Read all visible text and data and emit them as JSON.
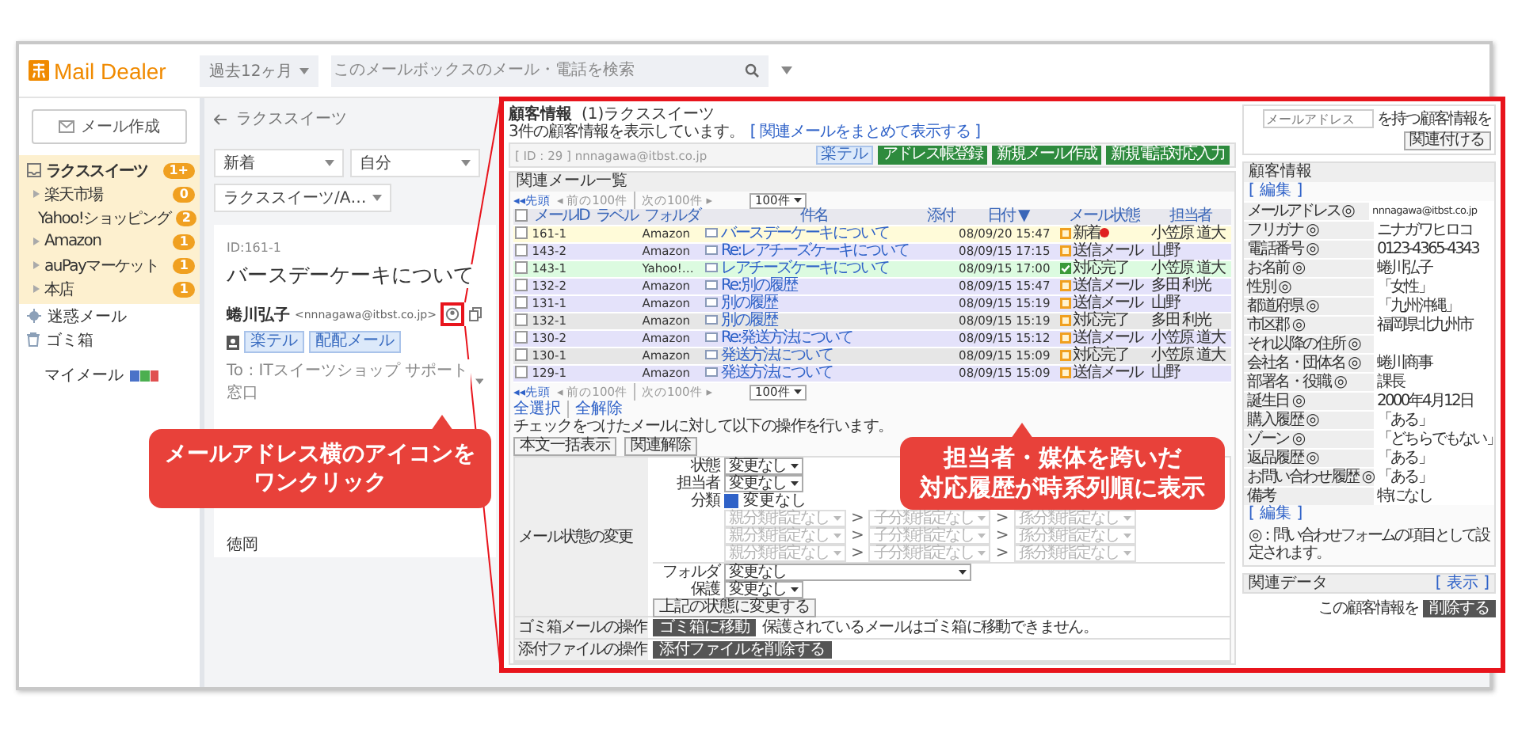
{
  "app": {
    "logo": "Mail Dealer",
    "period": "過去12ヶ月",
    "search_placeholder": "このメールボックスのメール・電話を検索"
  },
  "sidebar": {
    "compose": "メール作成",
    "folders": [
      {
        "label": "ラクススイーツ",
        "badge": "1+",
        "selected": true,
        "children": [
          {
            "label": "楽天市場",
            "badge": "0",
            "selected": false
          },
          {
            "label": "Yahoo!ショッピング",
            "badge": "2",
            "selected": false
          },
          {
            "label": "Amazon",
            "badge": "1",
            "selected": false
          },
          {
            "label": "auPayマーケット",
            "badge": "1",
            "selected": false
          },
          {
            "label": "本店",
            "badge": "1",
            "selected": false
          }
        ]
      }
    ],
    "others": [
      {
        "label": "迷惑メール",
        "kind": "spam"
      },
      {
        "label": "ゴミ箱",
        "kind": "trash"
      }
    ],
    "my_mail": "マイメール"
  },
  "mail": {
    "back": "ラクススイーツ",
    "filters": [
      "新着",
      "自分",
      "ラクススイーツ/A…"
    ],
    "id": "ID:161-1",
    "subject": "バースデーケーキについて",
    "sender": "蜷川弘子",
    "address": "<nnnagawa@itbst.co.jp>",
    "tags": [
      "楽テル",
      "配配メール"
    ],
    "to": "To : ITスイーツショップ サポート窓口",
    "signature": "徳岡"
  },
  "panel": {
    "title": "顧客情報",
    "subtitle": "(1)ラクススイーツ",
    "summary": "3件の顧客情報を表示しています。",
    "summary_link": "[ 関連メールをまとめて表示する ]",
    "record": "[ ID : 29 ]  nnnagawa@itbst.co.jp",
    "record_tag": "楽テル",
    "record_buttons": [
      "アドレス帳登録",
      "新規メール作成",
      "新規電話対応入力"
    ],
    "list_title": "関連メール一覧",
    "pager_top": {
      "first": "◂◂先頭",
      "prev": "◂ 前の100件",
      "next": "次の100件 ▸",
      "per_page": "100件"
    },
    "pager_bottom": {
      "first": "◂◂先頭",
      "prev": "◂ 前の100件",
      "next": "次の100件 ▸",
      "per_page": "100件"
    },
    "select_all_checked": false,
    "columns": [
      "メールID",
      "ラベル",
      "フォルダ",
      "件名",
      "添付",
      "日付 ▼",
      "メール状態",
      "担当者"
    ],
    "rows": [
      {
        "checked": false,
        "id": "161-1",
        "folder": "Amazon",
        "subject": "バースデーケーキについて",
        "date": "08/09/20 15:47",
        "status": "新着",
        "kind": "box",
        "alert": true,
        "person": "小笠原 道大",
        "color": "#fffbd9"
      },
      {
        "checked": false,
        "id": "143-2",
        "folder": "Amazon",
        "subject": "Re:レアチーズケーキについて",
        "date": "08/09/15 17:15",
        "status": "送信メール",
        "kind": "box",
        "alert": false,
        "person": "山野",
        "color": "#e4e2fa"
      },
      {
        "checked": false,
        "id": "143-1",
        "folder": "Yahoo!…",
        "subject": "レアチーズケーキについて",
        "date": "08/09/15 17:00",
        "status": "対応完了",
        "kind": "check",
        "alert": false,
        "person": "小笠原 道大",
        "color": "#dcfbe0"
      },
      {
        "checked": false,
        "id": "132-2",
        "folder": "Amazon",
        "subject": "Re:別の履歴",
        "date": "08/09/15 15:47",
        "status": "送信メール",
        "kind": "box",
        "alert": false,
        "person": "多田 利光",
        "color": "#e4e2fa"
      },
      {
        "checked": false,
        "id": "131-1",
        "folder": "Amazon",
        "subject": "別の履歴",
        "date": "08/09/15 15:19",
        "status": "送信メール",
        "kind": "box",
        "alert": false,
        "person": "山野",
        "color": "#e4e2fa"
      },
      {
        "checked": false,
        "id": "132-1",
        "folder": "Amazon",
        "subject": "別の履歴",
        "date": "08/09/15 15:19",
        "status": "対応完了",
        "kind": "box",
        "alert": false,
        "person": "多田 利光",
        "color": "#e6e6e6"
      },
      {
        "checked": false,
        "id": "130-2",
        "folder": "Amazon",
        "subject": "Re:発送方法について",
        "date": "08/09/15 15:12",
        "status": "送信メール",
        "kind": "box",
        "alert": false,
        "person": "小笠原 道大",
        "color": "#e4e2fa"
      },
      {
        "checked": false,
        "id": "130-1",
        "folder": "Amazon",
        "subject": "発送方法について",
        "date": "08/09/15 15:09",
        "status": "対応完了",
        "kind": "box",
        "alert": false,
        "person": "小笠原 道大",
        "color": "#e6e6e6"
      },
      {
        "checked": false,
        "id": "129-1",
        "folder": "Amazon",
        "subject": "発送方法について",
        "date": "08/09/15 15:09",
        "status": "送信メール",
        "kind": "box",
        "alert": false,
        "person": "山野",
        "color": "#e4e2fa"
      }
    ],
    "select_links": [
      "全選択",
      "全解除"
    ],
    "instruction": "チェックをつけたメールに対して以下の操作を行います。",
    "bulk_buttons": [
      "本文一括表示",
      "関連解除"
    ],
    "form": {
      "label": "メール状態の変更",
      "fields": [
        {
          "label": "状態",
          "value": "変更なし"
        },
        {
          "label": "担当者",
          "value": "変更なし"
        }
      ],
      "category": {
        "label": "分類",
        "checked": true,
        "text": "変更なし",
        "disabled": true,
        "separator": ">",
        "rows": [
          [
            "親分類指定なし",
            "子分類指定なし",
            "孫分類指定なし"
          ],
          [
            "親分類指定なし",
            "子分類指定なし",
            "孫分類指定なし"
          ],
          [
            "親分類指定なし",
            "子分類指定なし",
            "孫分類指定なし"
          ]
        ]
      },
      "folder": {
        "label": "フォルダ",
        "value": "変更なし"
      },
      "protect": {
        "label": "保護",
        "value": "変更なし"
      },
      "apply": "上記の状態に変更する"
    },
    "trash": {
      "label": "ゴミ箱メールの操作",
      "button": "ゴミ箱に移動",
      "note": "保護されているメールはゴミ箱に移動できません。"
    },
    "attach": {
      "label": "添付ファイルの操作",
      "button": "添付ファイルを削除する"
    }
  },
  "customer": {
    "search_placeholder": "メールアドレス",
    "search_suffix": "を持つ顧客情報を",
    "link_button": "関連付ける",
    "title": "顧客情報",
    "edit": "[ 編集 ]",
    "fields": [
      {
        "label": "メールアドレス ◎",
        "value": "nnnagawa@itbst.co.jp"
      },
      {
        "label": "フリガナ ◎",
        "value": "ニナガワヒロコ"
      },
      {
        "label": "電話番号 ◎",
        "value": "0123-4365-4343"
      },
      {
        "label": "お名前 ◎",
        "value": "蜷川弘子"
      },
      {
        "label": "性別 ◎",
        "value": "「女性」"
      },
      {
        "label": "都道府県 ◎",
        "value": "「九州沖縄」"
      },
      {
        "label": "市区郡 ◎",
        "value": "福岡県北九州市"
      },
      {
        "label": "それ以降の住所 ◎"
      },
      {
        "label": "会社名・団体名 ◎",
        "value": "蜷川商事"
      },
      {
        "label": "部署名・役職 ◎",
        "value": "課長"
      },
      {
        "label": "誕生日 ◎",
        "value": "2000年4月12日"
      },
      {
        "label": "購入履歴 ◎",
        "value": "「ある」"
      },
      {
        "label": "ゾーン ◎",
        "value": "「どちらでもない」"
      },
      {
        "label": "返品履歴 ◎",
        "value": "「ある」"
      },
      {
        "label": "お問い合わせ履歴 ◎",
        "value": "「ある」"
      },
      {
        "label": "備考",
        "value": "特になし"
      }
    ],
    "edit_bottom": "[ 編集 ]",
    "note": "◎：問い合わせフォームの項目として設定されます。",
    "related": "関連データ",
    "related_toggle": "[ 表示 ]",
    "delete_prefix": "この顧客情報を",
    "delete": "削除する"
  },
  "callouts": [
    {
      "lines": [
        "メールアドレス横のアイコンを",
        "ワンクリック"
      ]
    },
    {
      "lines": [
        "担当者・媒体を跨いだ",
        "対応履歴が時系列順に表示"
      ]
    }
  ]
}
